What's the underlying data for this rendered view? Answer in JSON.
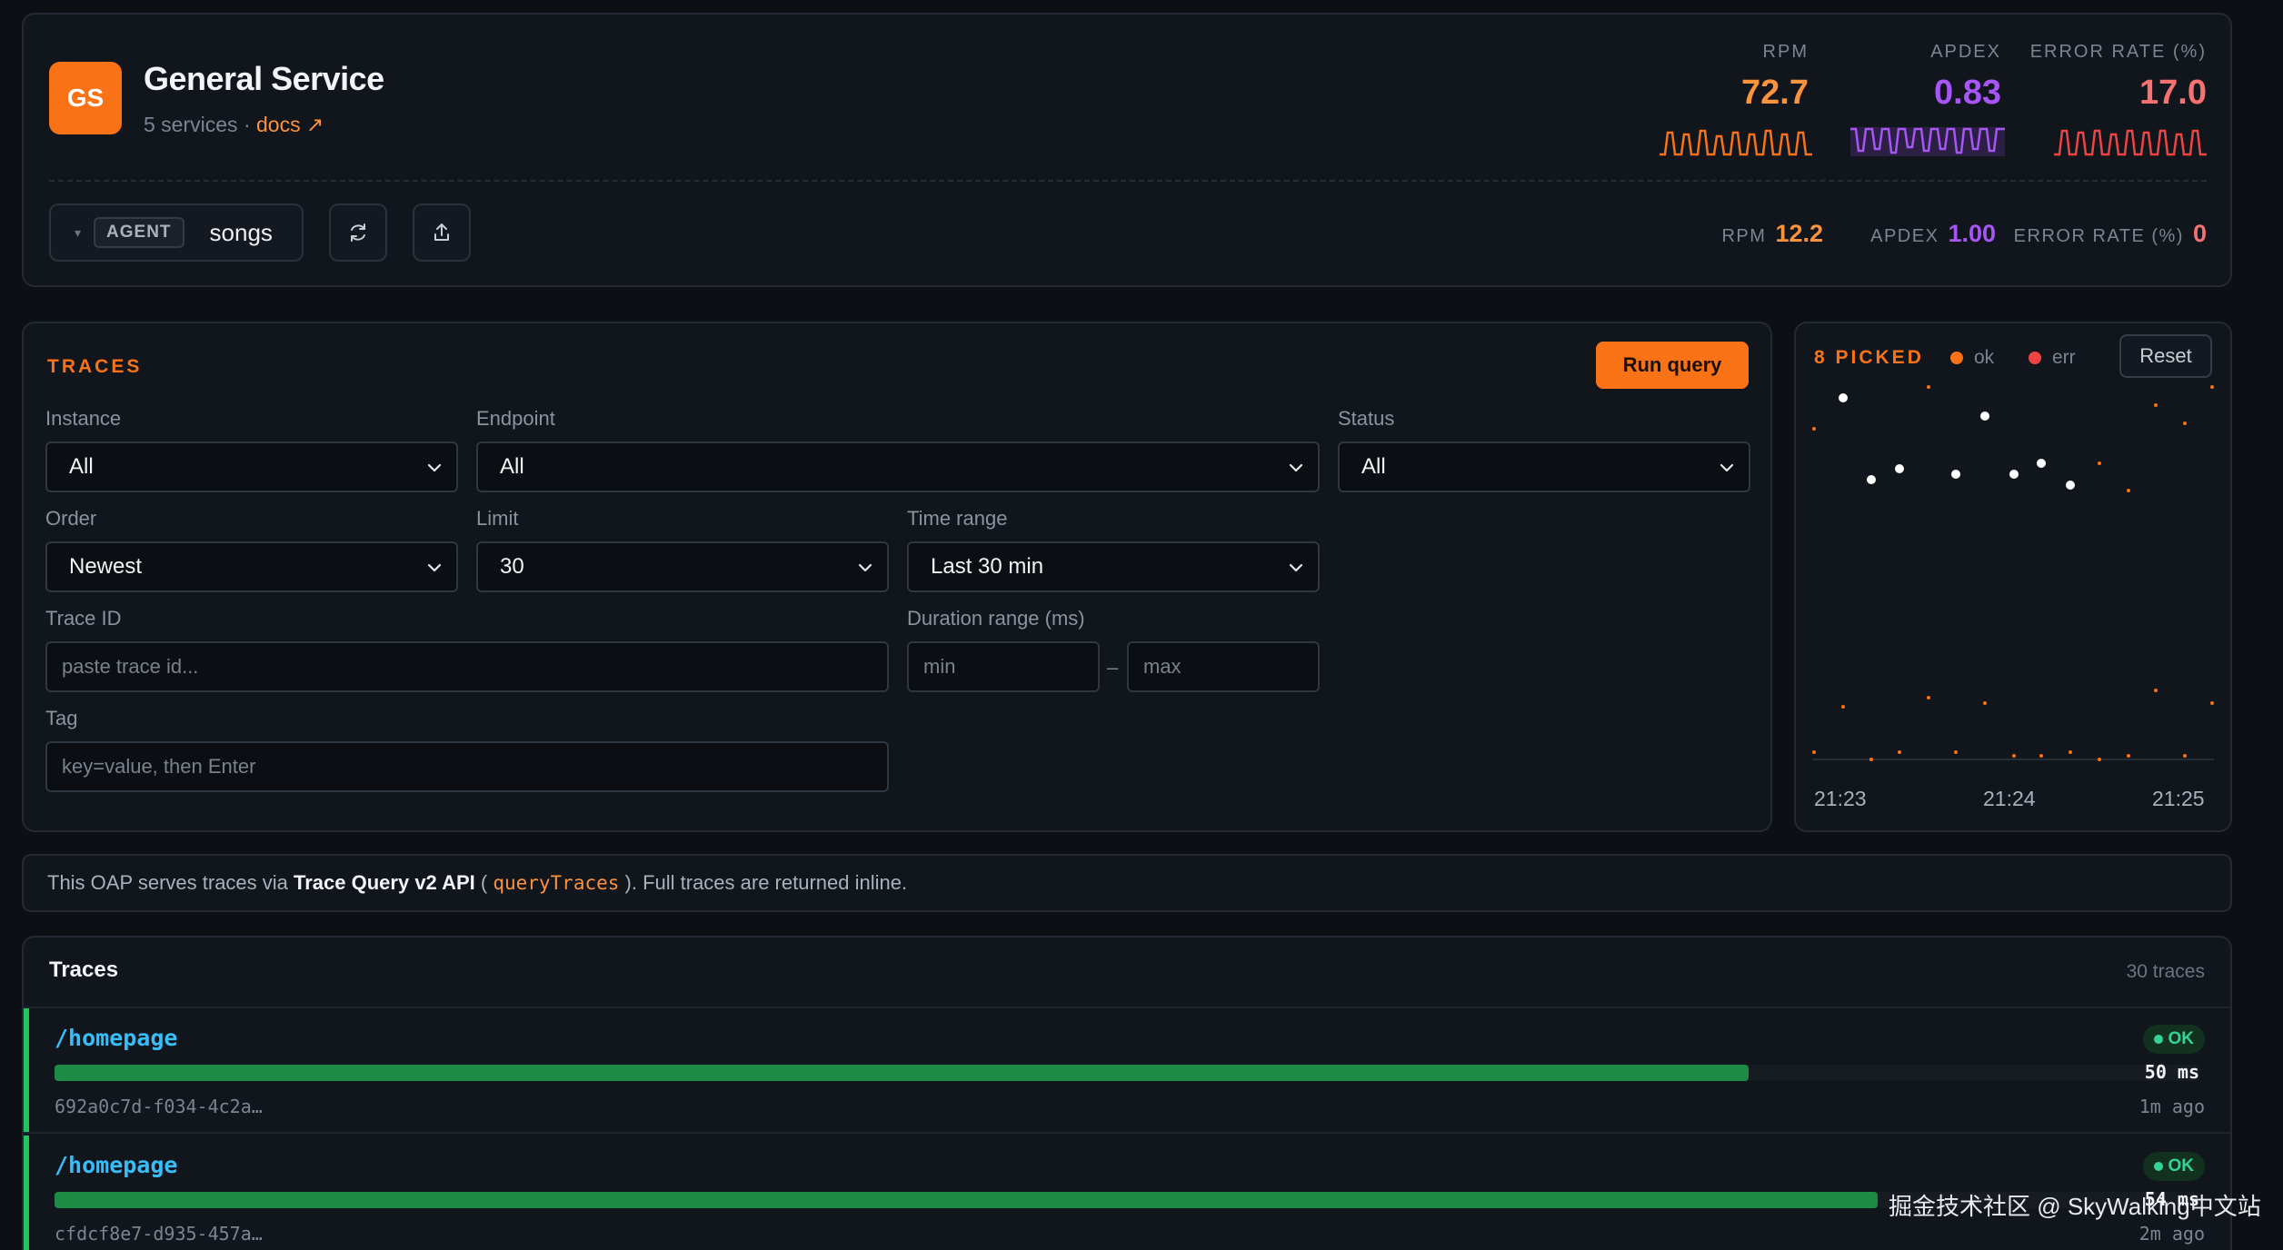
{
  "service": {
    "initials": "GS",
    "name": "General Service",
    "services_count": "5 services",
    "separator": "·",
    "docs_label": "docs ↗",
    "logo_color": "#f97316"
  },
  "agent": {
    "tag": "AGENT",
    "value": "songs",
    "caret": "▾"
  },
  "toolbar": {
    "refresh_icon": "refresh-icon",
    "share_icon": "share-icon"
  },
  "metrics": [
    {
      "label": "RPM",
      "value": "72.7",
      "color": "#fb923c"
    },
    {
      "label": "APDEX",
      "value": "0.83",
      "color": "#a855f7"
    },
    {
      "label": "ERROR RATE (%)",
      "value": "17.0",
      "color": "#f87171"
    }
  ],
  "mini_metrics": [
    {
      "label": "RPM",
      "value": "12.2",
      "color": "#fb923c"
    },
    {
      "label": "APDEX",
      "value": "1.00",
      "color": "#a855f7"
    },
    {
      "label": "ERROR RATE (%)",
      "value": "0",
      "color": "#f87171"
    }
  ],
  "query": {
    "section_title": "TRACES",
    "run_label": "Run query",
    "instance": {
      "label": "Instance",
      "value": "All"
    },
    "endpoint": {
      "label": "Endpoint",
      "value": "All"
    },
    "status": {
      "label": "Status",
      "value": "All"
    },
    "order": {
      "label": "Order",
      "value": "Newest"
    },
    "limit": {
      "label": "Limit",
      "value": "30"
    },
    "time_range": {
      "label": "Time range",
      "value": "Last 30 min"
    },
    "trace_id": {
      "label": "Trace ID",
      "placeholder": "paste trace id..."
    },
    "duration": {
      "label": "Duration range (ms)",
      "min_placeholder": "min",
      "max_placeholder": "max",
      "separator": "–"
    },
    "tag": {
      "label": "Tag",
      "placeholder": "key=value, then Enter"
    }
  },
  "scatter": {
    "picked_label": "8 PICKED",
    "legend_ok": "ok",
    "legend_err": "err",
    "reset_label": "Reset",
    "x_ticks": [
      "21:23",
      "21:24",
      "21:25"
    ],
    "colors": {
      "ok": "#f97316",
      "err": "#ef4444",
      "picked": "#ffffff"
    }
  },
  "info": {
    "prefix": "This OAP serves traces via ",
    "api_name": "Trace Query v2 API",
    "open_paren": " ( ",
    "function": "queryTraces",
    "suffix": " ). Full traces are returned inline."
  },
  "traces": {
    "title": "Traces",
    "count": "30 traces",
    "rows": [
      {
        "endpoint": "/homepage",
        "trace_id": "692a0c7d-f034-4c2a…",
        "status": "OK",
        "duration": "50 ms",
        "ago": "1m ago",
        "bar_fraction": 0.79
      },
      {
        "endpoint": "/homepage",
        "trace_id": "cfdcf8e7-d935-457a…",
        "status": "OK",
        "duration": "54 ms",
        "ago": "2m ago",
        "bar_fraction": 0.85
      }
    ]
  },
  "watermark": "掘金技术社区 @ SkyWalking中文站"
}
